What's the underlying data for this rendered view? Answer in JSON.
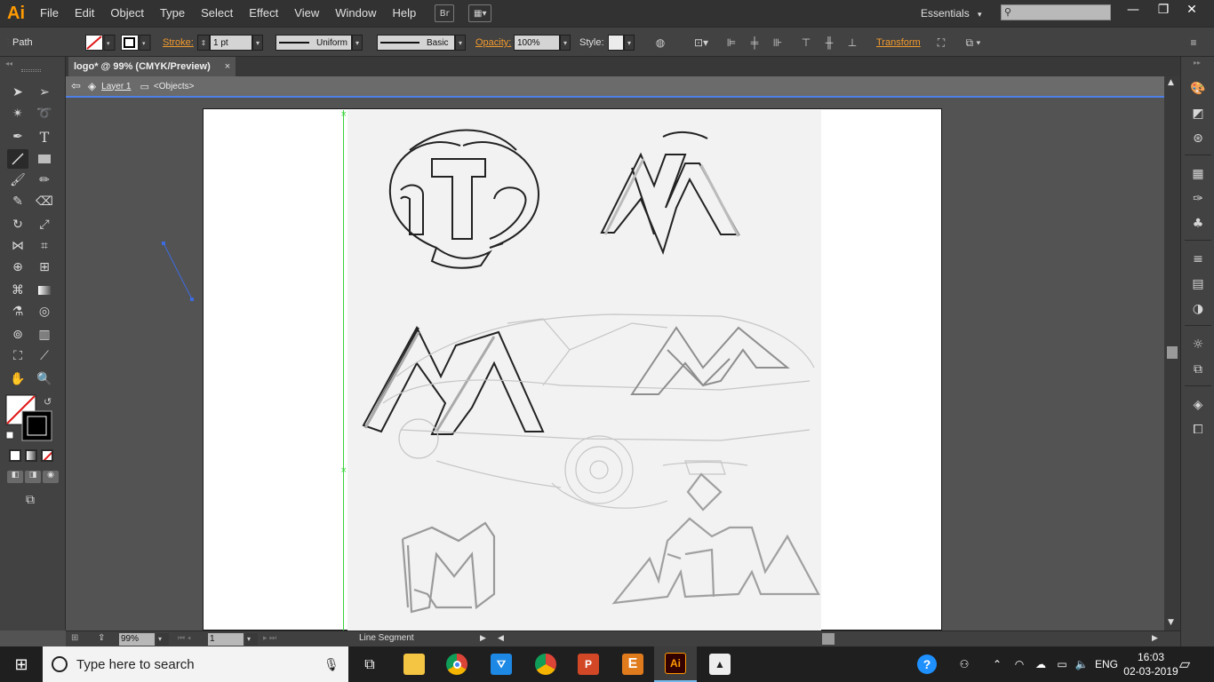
{
  "app": {
    "logo": "Ai",
    "name": "Adobe Illustrator"
  },
  "menu": [
    "File",
    "Edit",
    "Object",
    "Type",
    "Select",
    "Effect",
    "View",
    "Window",
    "Help"
  ],
  "menubar": {
    "bridge_label": "Br",
    "workspace": "Essentials",
    "search_placeholder": ""
  },
  "control": {
    "selection_type": "Path",
    "stroke_label": "Stroke:",
    "stroke_weight": "1 pt",
    "variable_width": "Uniform",
    "brush": "Basic",
    "opacity_label": "Opacity:",
    "opacity": "100%",
    "style_label": "Style:",
    "transform_label": "Transform"
  },
  "document": {
    "tab_title": "logo* @ 99% (CMYK/Preview)",
    "tab_close": "×",
    "layer": "Layer 1",
    "objects": "<Objects>"
  },
  "status": {
    "zoom": "99%",
    "artboard": "1",
    "current_tool": "Line Segment"
  },
  "taskbar": {
    "search_placeholder": "Type here to search",
    "language": "ENG",
    "time": "16:03",
    "date": "02-03-2019"
  },
  "colors": {
    "accent_orange": "#ff9a00",
    "isolation_blue": "#4d7fe8",
    "guide_green": "#3ad33a",
    "selection_blue": "#3d6be0"
  }
}
